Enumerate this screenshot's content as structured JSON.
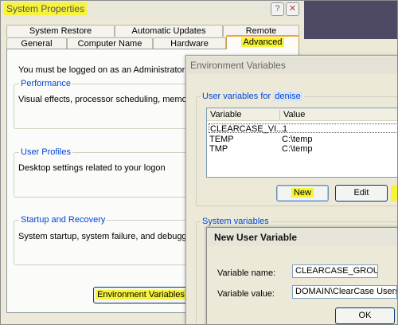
{
  "system_properties": {
    "title": "System Properties",
    "help_glyph": "?",
    "close_glyph": "✕",
    "tabs_row1": [
      "System Restore",
      "Automatic Updates",
      "Remote"
    ],
    "tabs_row2": [
      "General",
      "Computer Name",
      "Hardware",
      "Advanced"
    ],
    "admin_notice": "You must be logged on as an Administrator to ma",
    "performance": {
      "label": "Performance",
      "text": "Visual effects, processor scheduling, memory us"
    },
    "user_profiles": {
      "label": "User Profiles",
      "text": "Desktop settings related to your logon"
    },
    "startup_recovery": {
      "label": "Startup and Recovery",
      "text": "System startup, system failure, and debugging i"
    },
    "env_button": "Environment Variables"
  },
  "env_vars": {
    "title": "Environment Variables",
    "user_group_label": "User variables for",
    "user_name": "denise",
    "columns": [
      "Variable",
      "Value"
    ],
    "rows": [
      {
        "variable": "CLEARCASE_VI...",
        "value": "1"
      },
      {
        "variable": "TEMP",
        "value": "C:\\temp"
      },
      {
        "variable": "TMP",
        "value": "C:\\temp"
      }
    ],
    "new_button": "New",
    "edit_button": "Edit",
    "system_group_label": "System variables"
  },
  "new_user_variable": {
    "title": "New User Variable",
    "name_label": "Variable name:",
    "name_value": "CLEARCASE_GROUPS",
    "value_label": "Variable value:",
    "value_value": "DOMAIN\\ClearCase Users;Do",
    "ok_button": "OK"
  },
  "colors": {
    "highlight": "#f6f33a",
    "group_label": "#0046d5",
    "purple_bg": "#4e4a65"
  }
}
